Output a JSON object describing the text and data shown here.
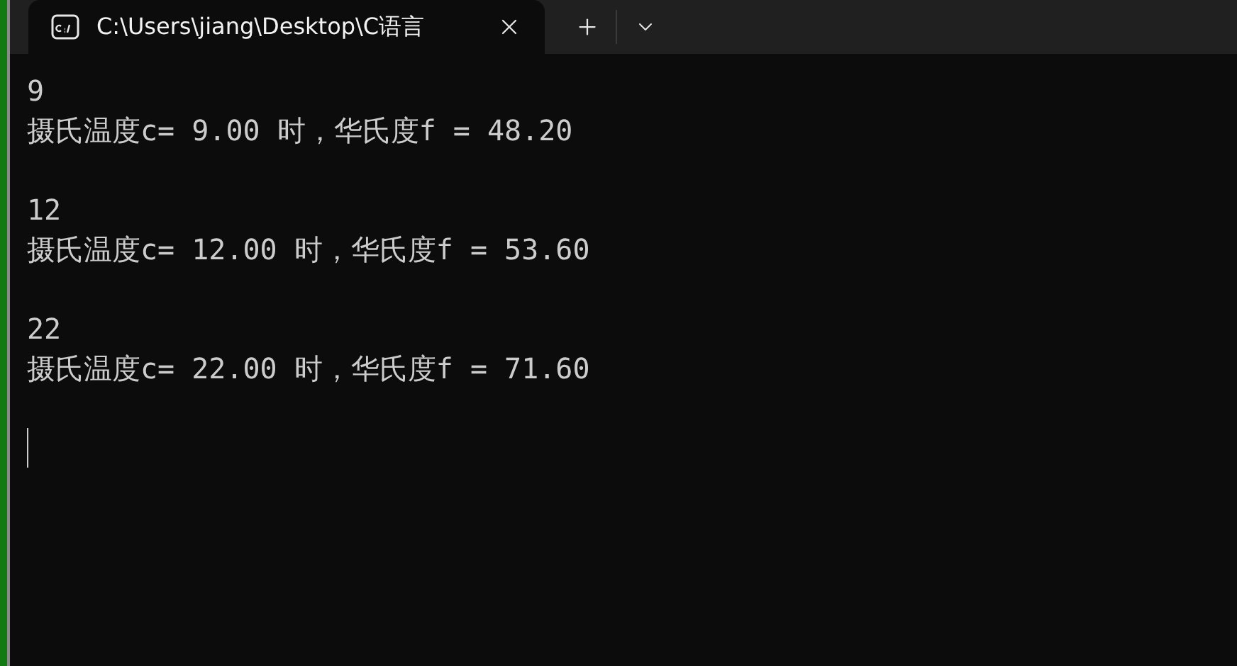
{
  "tabs": [
    {
      "title": "C:\\Users\\jiang\\Desktop\\C语言",
      "selected": true
    }
  ],
  "outputs": [
    {
      "input": "9",
      "result": "摄氏温度c= 9.00 时，华氏度f = 48.20"
    },
    {
      "input": "12",
      "result": "摄氏温度c= 12.00 时，华氏度f = 53.60"
    },
    {
      "input": "22",
      "result": "摄氏温度c= 22.00 时，华氏度f = 71.60"
    }
  ]
}
